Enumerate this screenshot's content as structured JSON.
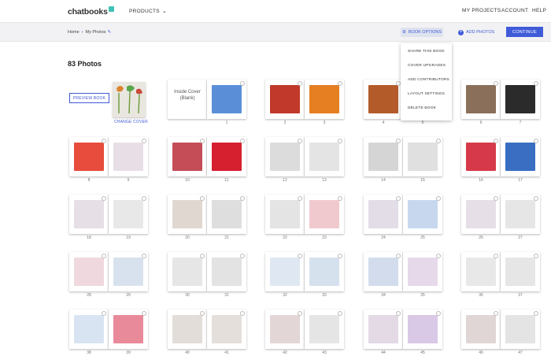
{
  "header": {
    "logo": "chatbooks",
    "products": "PRODUCTS",
    "my_projects": "MY PROJECTS",
    "account": "ACCOUNT",
    "help": "HELP"
  },
  "toolbar": {
    "crumb_home": "Home",
    "crumb_current": "My Photos",
    "book_options": "BOOK OPTIONS",
    "add_photos": "ADD PHOTOS",
    "continue": "CONTINUE"
  },
  "main": {
    "title": "83 Photos",
    "preview_book": "PREVIEW BOOK",
    "change_cover": "CHANGE COVER",
    "inside_cover": "Inside Cover (Blank)"
  },
  "dropdown": {
    "items": [
      "SHARE THIS BOOK",
      "COVER UPGRADES",
      "ADD CONTRIBUTORS",
      "LAYOUT SETTINGS",
      "DELETE BOOK"
    ]
  },
  "pages": [
    {
      "n": "1",
      "art": "#5a8fd8"
    },
    {
      "n": "2",
      "art": "#c0392b"
    },
    {
      "n": "3",
      "art": "#e67e22"
    },
    {
      "n": "4",
      "art": "#b35c2a"
    },
    {
      "n": "5",
      "art": "#e0e0e0"
    },
    {
      "n": "6",
      "art": "#8a6f5a"
    },
    {
      "n": "7",
      "art": "#2b2b2b"
    },
    {
      "n": "8",
      "art": "#e74c3c"
    },
    {
      "n": "9",
      "art": "#e8dfe6"
    },
    {
      "n": "10",
      "art": "#c44d58"
    },
    {
      "n": "11",
      "art": "#d6202f"
    },
    {
      "n": "12",
      "art": "#dcdcdc"
    },
    {
      "n": "13",
      "art": "#e4e4e4"
    },
    {
      "n": "14",
      "art": "#d5d5d5"
    },
    {
      "n": "15",
      "art": "#e0e0e0"
    },
    {
      "n": "16",
      "art": "#d63a4a"
    },
    {
      "n": "17",
      "art": "#3a6ec2"
    },
    {
      "n": "18",
      "art": "#e6dfe6"
    },
    {
      "n": "19",
      "art": "#e8e8e8"
    },
    {
      "n": "20",
      "art": "#e0d8d0"
    },
    {
      "n": "21",
      "art": "#dedede"
    },
    {
      "n": "22",
      "art": "#e4e4e4"
    },
    {
      "n": "23",
      "art": "#f0c9cf"
    },
    {
      "n": "24",
      "art": "#e2dde6"
    },
    {
      "n": "25",
      "art": "#c7d8ee"
    },
    {
      "n": "26",
      "art": "#e7dfe8"
    },
    {
      "n": "27",
      "art": "#e6e6e6"
    },
    {
      "n": "28",
      "art": "#efd9de"
    },
    {
      "n": "29",
      "art": "#d8e2ee"
    },
    {
      "n": "30",
      "art": "#e6e6e6"
    },
    {
      "n": "31",
      "art": "#e3e3e3"
    },
    {
      "n": "32",
      "art": "#dfe8f2"
    },
    {
      "n": "33",
      "art": "#d6e1ee"
    },
    {
      "n": "34",
      "art": "#d2dcec"
    },
    {
      "n": "35",
      "art": "#e6d9ea"
    },
    {
      "n": "36",
      "art": "#e8e8e8"
    },
    {
      "n": "37",
      "art": "#e6e6e6"
    },
    {
      "n": "38",
      "art": "#d8e4f2"
    },
    {
      "n": "39",
      "art": "#e98a9a"
    },
    {
      "n": "40",
      "art": "#e2ddd8"
    },
    {
      "n": "41",
      "art": "#e4dfdb"
    },
    {
      "n": "42",
      "art": "#e2d6d6"
    },
    {
      "n": "43",
      "art": "#e5e5e5"
    },
    {
      "n": "44",
      "art": "#e3dae6"
    },
    {
      "n": "45",
      "art": "#d9c8e6"
    },
    {
      "n": "46",
      "art": "#e0d6d6"
    },
    {
      "n": "47",
      "art": "#e4e4e4"
    }
  ]
}
